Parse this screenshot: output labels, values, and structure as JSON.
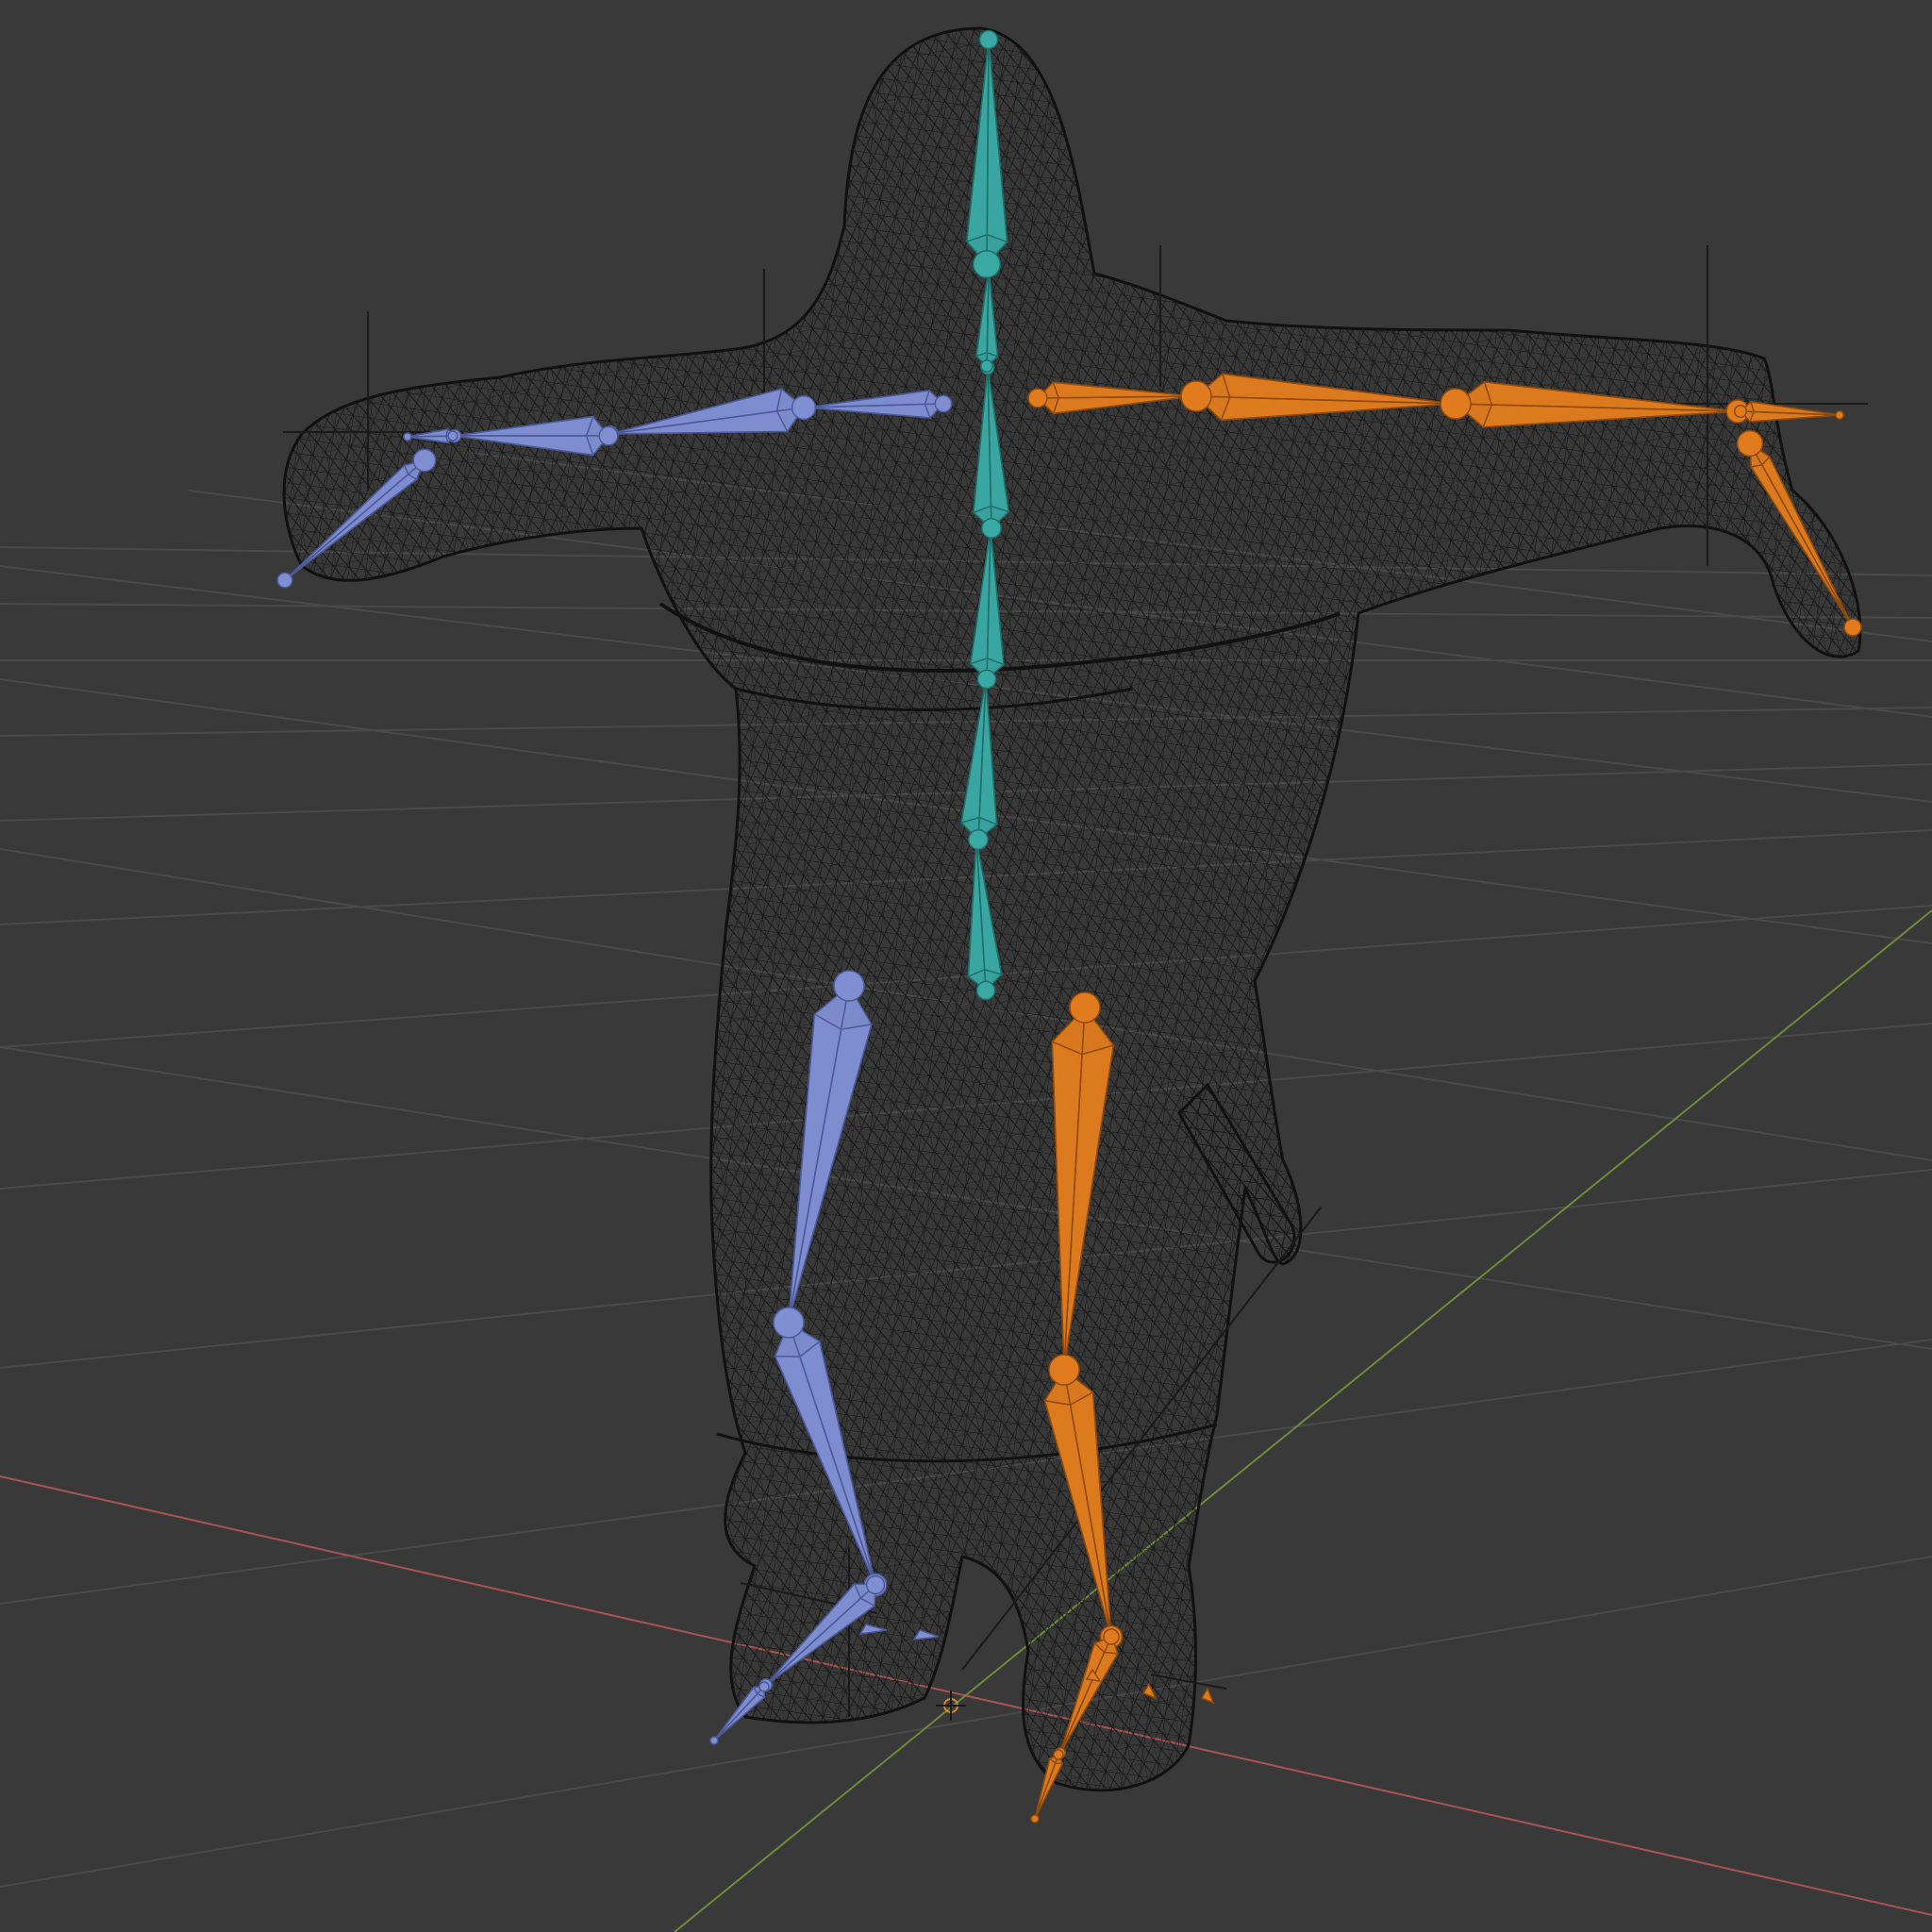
{
  "viewport": {
    "background": "#393939",
    "shading": "wireframe",
    "object": "armature"
  },
  "colors": {
    "grid": "#4a4a4a",
    "x_axis": "#a85454",
    "y_axis": "#6f8a3a",
    "mesh_wire": "#111111",
    "bone_center": "#3aa8a3",
    "bone_center_stroke": "#1f6e6a",
    "bone_left": "#7f8fd2",
    "bone_left_stroke": "#4c5a9a",
    "bone_right": "#e07b1e",
    "bone_right_stroke": "#8f4a0c",
    "empty": "#1a1a1a",
    "origin": "#d88a2a"
  },
  "bone_groups": [
    {
      "name": "spine",
      "color_key": "center"
    },
    {
      "name": "left",
      "color_key": "left"
    },
    {
      "name": "right",
      "color_key": "right"
    }
  ]
}
